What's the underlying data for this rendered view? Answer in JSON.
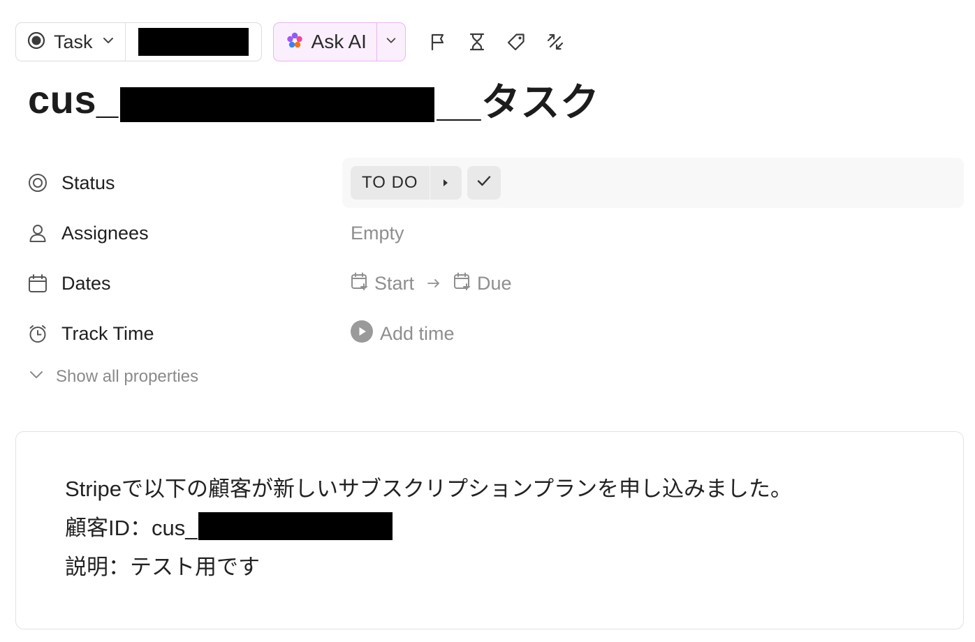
{
  "toolbar": {
    "task_type_label": "Task",
    "ask_ai_label": "Ask AI",
    "icons": [
      "flag-icon",
      "hourglass-icon",
      "tag-icon",
      "relationship-icon"
    ]
  },
  "title": {
    "prefix": "cus_",
    "suffix": "__タスク"
  },
  "properties": {
    "status": {
      "label": "Status",
      "value": "TO DO"
    },
    "assignees": {
      "label": "Assignees",
      "value": "Empty"
    },
    "dates": {
      "label": "Dates",
      "start": "Start",
      "due": "Due"
    },
    "track_time": {
      "label": "Track Time",
      "value": "Add time"
    }
  },
  "show_all_label": "Show all properties",
  "description": {
    "line1": "Stripeで以下の顧客が新しいサブスクリプションプランを申し込みました。",
    "line2_prefix": "顧客ID：cus_",
    "line3": "説明：テスト用です"
  },
  "colors": {
    "ai_bg": "#fbeffd",
    "ai_border": "#e6b7f1",
    "status_pill": "#e9e9e9",
    "muted_text": "#8e8e8e"
  }
}
